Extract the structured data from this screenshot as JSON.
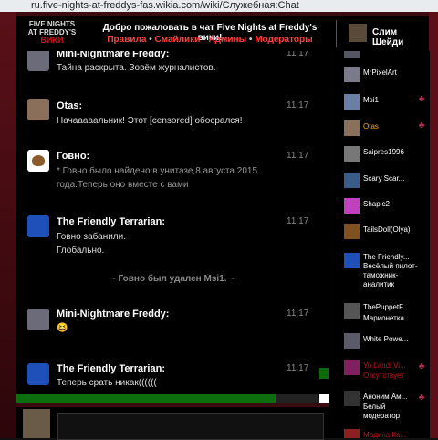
{
  "browser": {
    "url": "ru.five-nights-at-freddys-fas.wikia.com/wiki/Служебная:Chat"
  },
  "header": {
    "logo_line1": "FIVE NIGHTS",
    "logo_line2": "AT FREDDY'S",
    "logo_line3": "ВИКИ",
    "welcome": "Добро пожаловать в чат Five Nights at Freddy's вики!",
    "links": [
      {
        "label": "Правила"
      },
      {
        "label": "Смайлики"
      },
      {
        "label": "Админы"
      },
      {
        "label": "Модераторы"
      }
    ],
    "separator": "•",
    "current_user": "Слим Шейди"
  },
  "messages": [
    {
      "nick": "Mini-Nightmare Freddy:",
      "time": "11:17",
      "lines": [
        "Тайна раскрыта. Зовём журналистов."
      ]
    },
    {
      "nick": "Otas:",
      "time": "11:17",
      "lines": [
        "Начааааальник! Этот [censored] обосрался!"
      ]
    },
    {
      "nick": "Говно:",
      "time": "11:17",
      "lines": [
        "* Говно было найдено в унитазе,8 августа 2015",
        "года.Теперь оно вместе с вами"
      ]
    },
    {
      "nick": "The Friendly Terrarian:",
      "time": "11:17",
      "lines": [
        "Говно забанили.",
        "Глобально."
      ]
    },
    {
      "nick": "Mini-Nightmare Freddy:",
      "time": "11:17",
      "lines": [
        "😆"
      ]
    },
    {
      "nick": "The Friendly Terrarian:",
      "time": "11:17",
      "lines": [
        "Теперь срать никак(((((("
      ]
    }
  ],
  "system_message": "~ Говно был удален Msi1. ~",
  "users": [
    {
      "name": "MrPixelArt",
      "status": "",
      "color": "#ffffff",
      "moderator": false
    },
    {
      "name": "Msi1",
      "status": "",
      "color": "#ffffff",
      "moderator": true
    },
    {
      "name": "Otas",
      "status": "",
      "color": "#f5a623",
      "moderator": true
    },
    {
      "name": "Saipres1996",
      "status": "",
      "color": "#ffffff",
      "moderator": false
    },
    {
      "name": "Scary Scar...",
      "status": "",
      "color": "#ffffff",
      "moderator": false
    },
    {
      "name": "Shapic2",
      "status": "",
      "color": "#ffffff",
      "moderator": false
    },
    {
      "name": "TailsDoll(Olya)",
      "status": "",
      "color": "#ffffff",
      "moderator": false
    },
    {
      "name": "The Friendly...",
      "status": "Весёлый пилот-таможник-аналитик",
      "color": "#ffffff",
      "moderator": false
    },
    {
      "name": "ThePuppetF...",
      "status": "Марионетка",
      "color": "#ffffff",
      "moderator": false
    },
    {
      "name": "White Powe...",
      "status": "",
      "color": "#ffffff",
      "moderator": false
    },
    {
      "name": "Yo Landi Vi...",
      "status": "Отсутствует",
      "color": "#c0141b",
      "moderator": true
    },
    {
      "name": "Аноним Ам...",
      "status": "Белый модератор",
      "color": "#ffffff",
      "moderator": true
    },
    {
      "name": "Мадина Ко...",
      "status": "",
      "color": "#c0141b",
      "moderator": false
    }
  ]
}
